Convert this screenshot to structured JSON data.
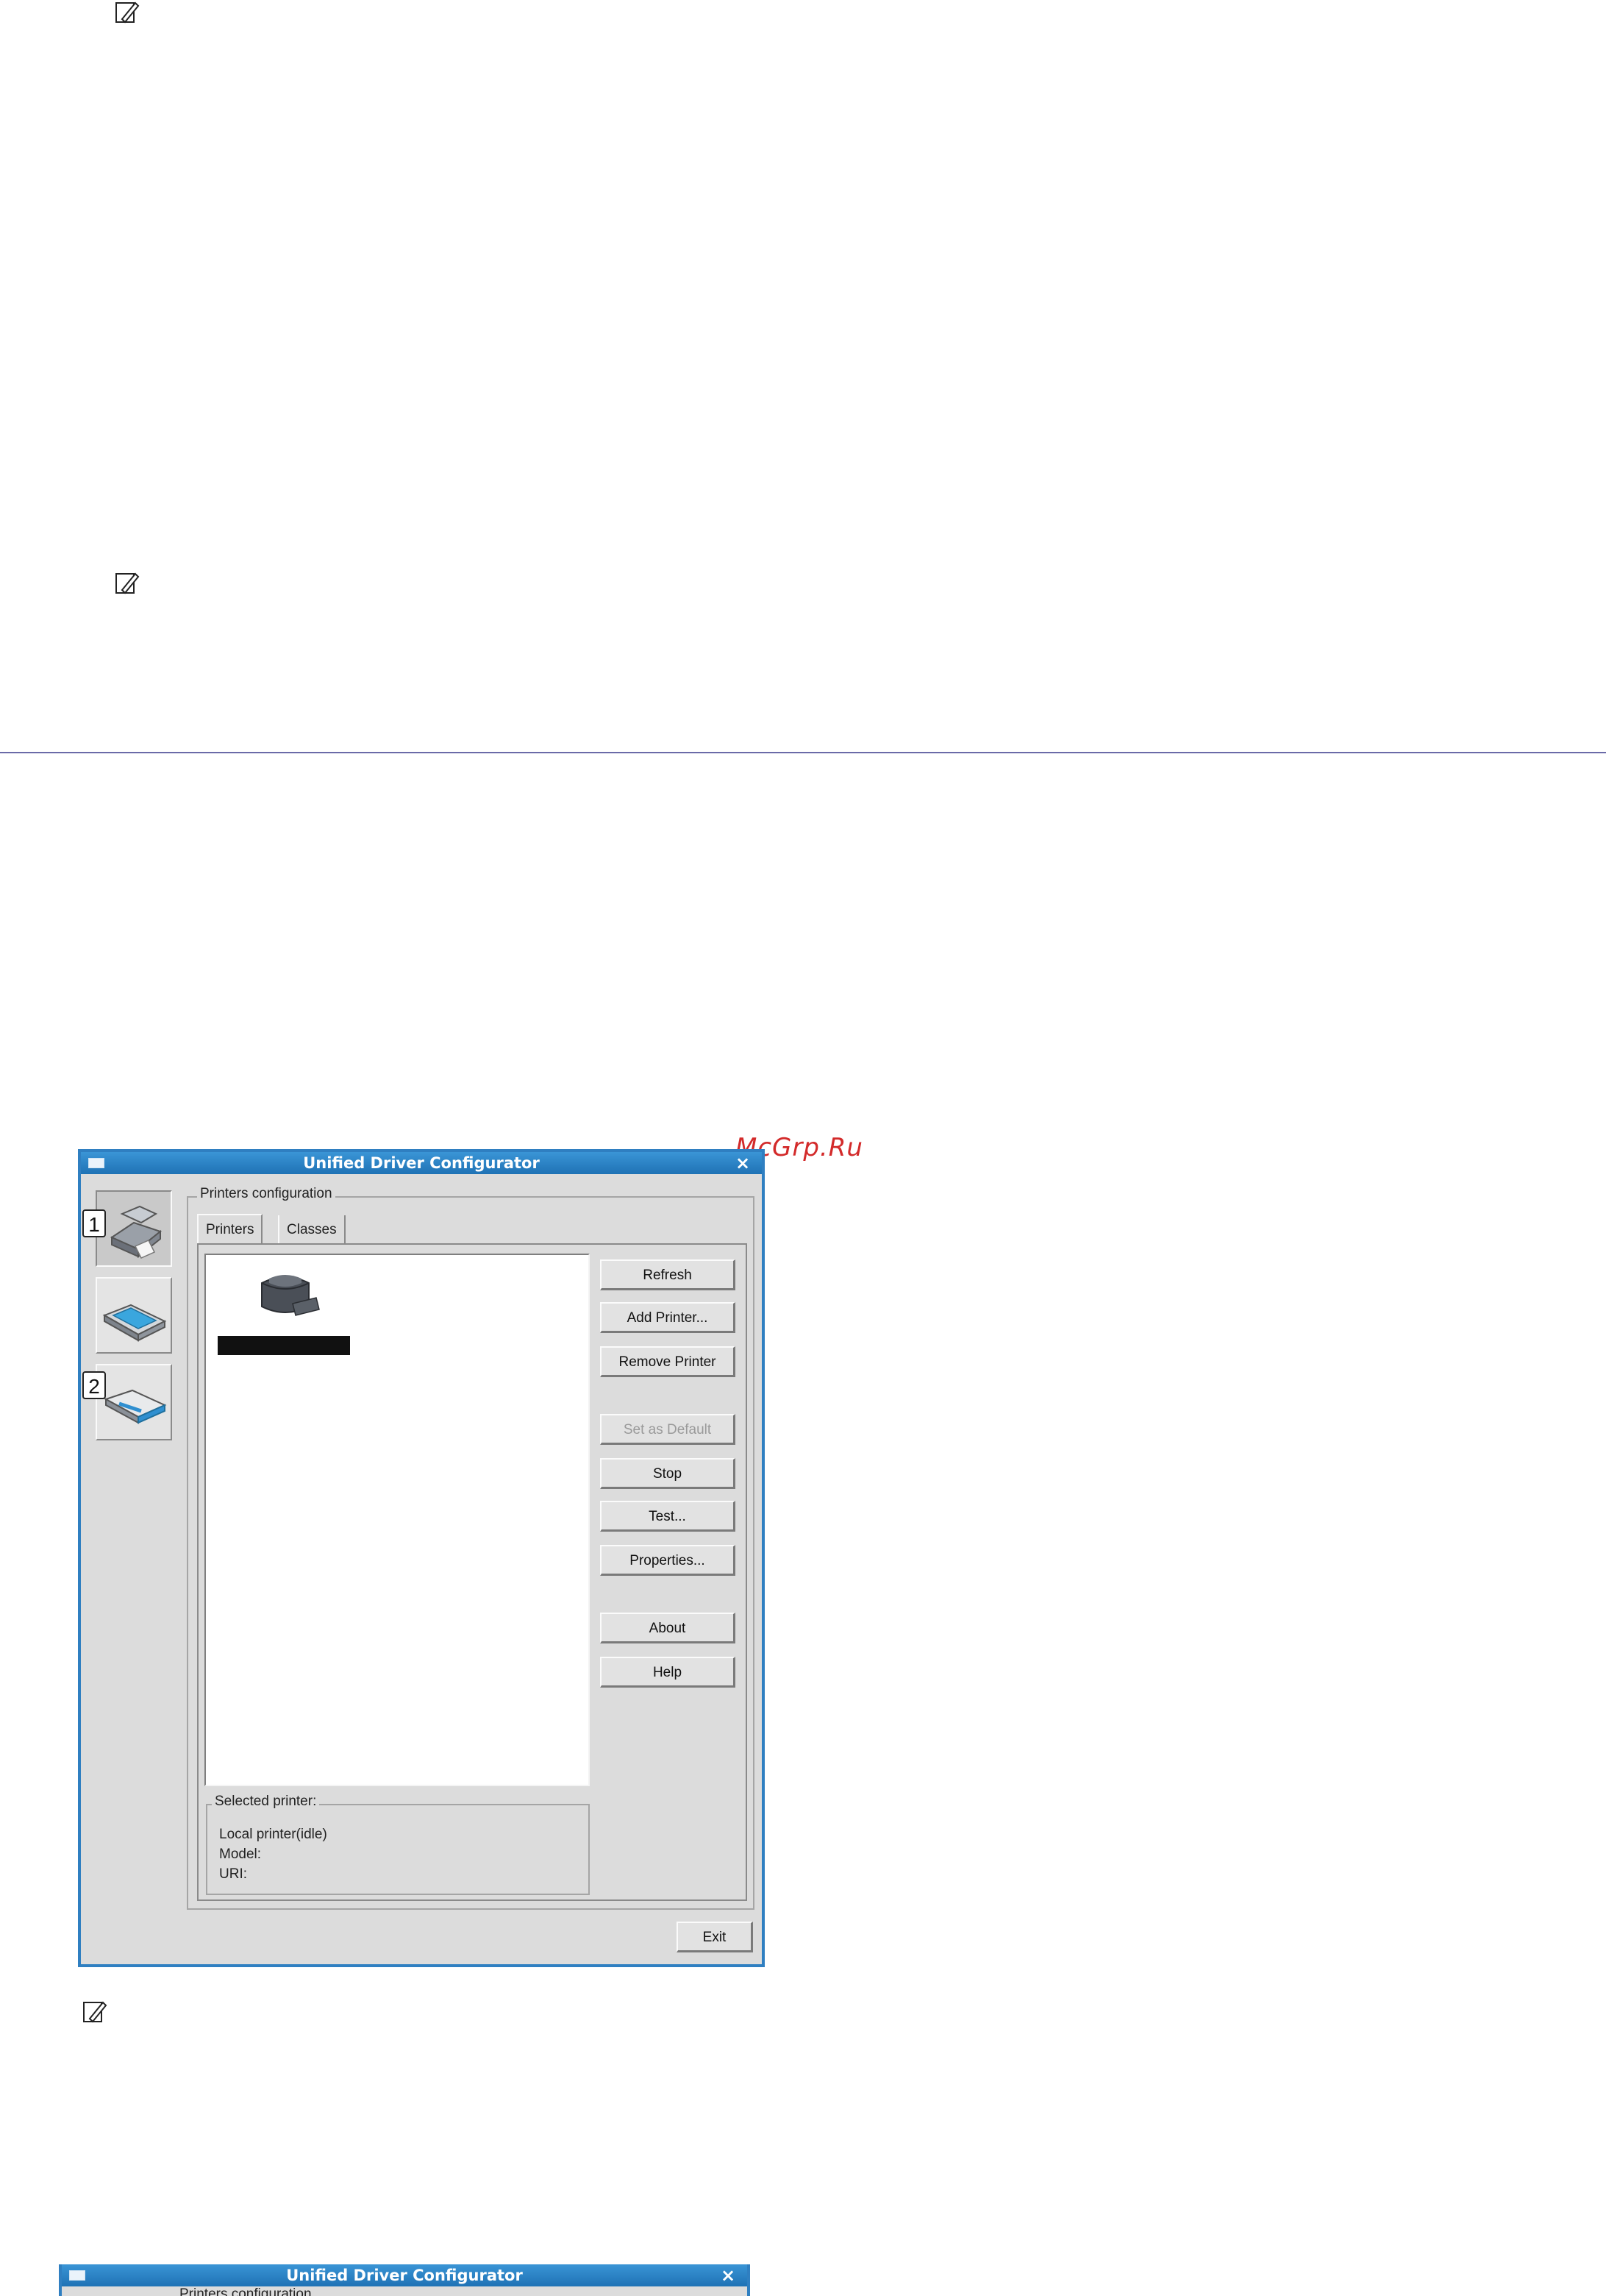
{
  "window": {
    "title": "Unified Driver Configurator",
    "close_glyph": "×"
  },
  "watermark": "McGrp.Ru",
  "sidebar": {
    "items": [
      {
        "icon": "printer-icon",
        "callout": "1"
      },
      {
        "icon": "scanner-icon",
        "callout": ""
      },
      {
        "icon": "port-icon",
        "callout": "2"
      }
    ]
  },
  "printers_config": {
    "label": "Printers configuration",
    "tabs": [
      {
        "label": "Printers",
        "selected": true
      },
      {
        "label": "Classes",
        "selected": false
      }
    ]
  },
  "buttons": {
    "refresh": "Refresh",
    "add_printer": "Add Printer...",
    "remove_printer": "Remove Printer",
    "set_default": "Set as Default",
    "stop": "Stop",
    "test": "Test...",
    "properties": "Properties...",
    "about": "About",
    "help": "Help",
    "exit": "Exit"
  },
  "selected_printer": {
    "label": "Selected printer:",
    "status": "Local printer(idle)",
    "model_label": "Model:",
    "uri_label": "URI:"
  },
  "second_window": {
    "title": "Unified Driver Configurator",
    "close_glyph": "×",
    "group_label": "Printers configuration"
  },
  "colors": {
    "titlebar": "#2f7fc1",
    "rule": "#6a6aa8",
    "watermark": "#d32a2a"
  }
}
